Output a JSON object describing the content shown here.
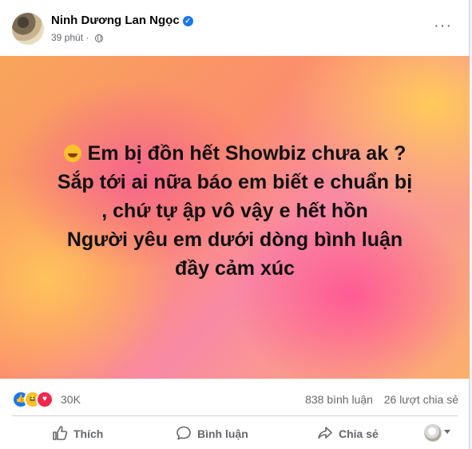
{
  "post": {
    "author": "Ninh Dương Lan Ngọc",
    "time": "39 phút",
    "more_icon": "more-horizontal-icon"
  },
  "content": {
    "lines": [
      "Em bị đồn hết Showbiz chưa ak ?",
      "Sắp tới ai nữa báo em biết e chuẩn bị",
      ", chứ tự ập vô vậy e hết hồn",
      "Người yêu em dưới dòng bình luận",
      "đầy cảm xúc"
    ],
    "emoji": "rolling-on-floor-laughing"
  },
  "stats": {
    "reactions_count": "30K",
    "comments": "838 bình luận",
    "shares": "26 lượt chia sẻ"
  },
  "actions": {
    "like": "Thích",
    "comment": "Bình luận",
    "share": "Chia sẻ"
  },
  "colors": {
    "facebook_blue": "#1877f2",
    "love_red": "#f02849",
    "haha_yellow": "#f7c22b",
    "secondary_text": "#65676b"
  }
}
